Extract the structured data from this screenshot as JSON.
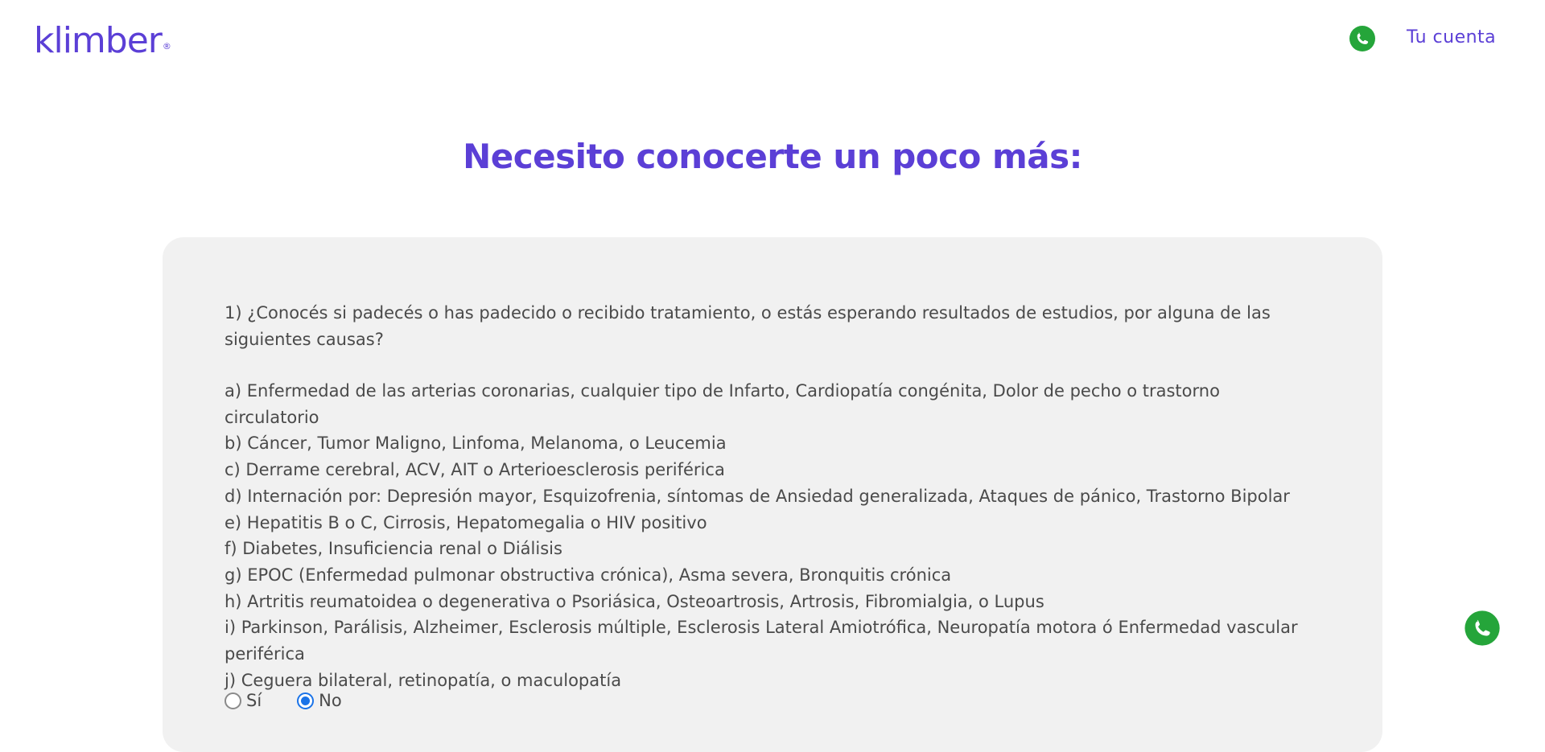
{
  "header": {
    "logo_text": "klimber",
    "logo_reg": "®",
    "account_link": "Tu cuenta",
    "whatsapp_icon": "whatsapp-icon"
  },
  "page": {
    "title": "Necesito conocerte un poco más:"
  },
  "question": {
    "text": "1) ¿Conocés si padecés o has padecido o recibido tratamiento, o estás esperando resultados de estudios, por alguna de las siguientes causas?",
    "options": [
      "a) Enfermedad de las arterias coronarias, cualquier tipo de Infarto, Cardiopatía congénita, Dolor de pecho o trastorno circulatorio",
      "b) Cáncer, Tumor Maligno, Linfoma, Melanoma, o Leucemia",
      "c) Derrame cerebral, ACV, AIT o Arterioesclerosis periférica",
      "d) Internación por: Depresión mayor, Esquizofrenia, síntomas de Ansiedad generalizada, Ataques de pánico, Trastorno Bipolar",
      "e) Hepatitis B o C, Cirrosis, Hepatomegalia o HIV positivo",
      "f) Diabetes, Insuficiencia renal o Diálisis",
      "g) EPOC (Enfermedad pulmonar obstructiva crónica), Asma severa, Bronquitis crónica",
      "h) Artritis reumatoidea o degenerativa o Psoriásica, Osteoartrosis, Artrosis, Fibromialgia, o Lupus",
      "i) Parkinson, Parálisis, Alzheimer, Esclerosis múltiple, Esclerosis Lateral Amiotrófica, Neuropatía motora ó Enfermedad vascular periférica",
      "j) Ceguera bilateral, retinopatía, o maculopatía"
    ],
    "answers": [
      {
        "label": "Sí",
        "checked": false
      },
      {
        "label": "No",
        "checked": true
      }
    ]
  },
  "colors": {
    "brand": "#5b3fd6",
    "whatsapp": "#25a53a",
    "radio_checked": "#1a73e8",
    "card_bg": "#f1f1f1",
    "text": "#4a4a4a"
  }
}
